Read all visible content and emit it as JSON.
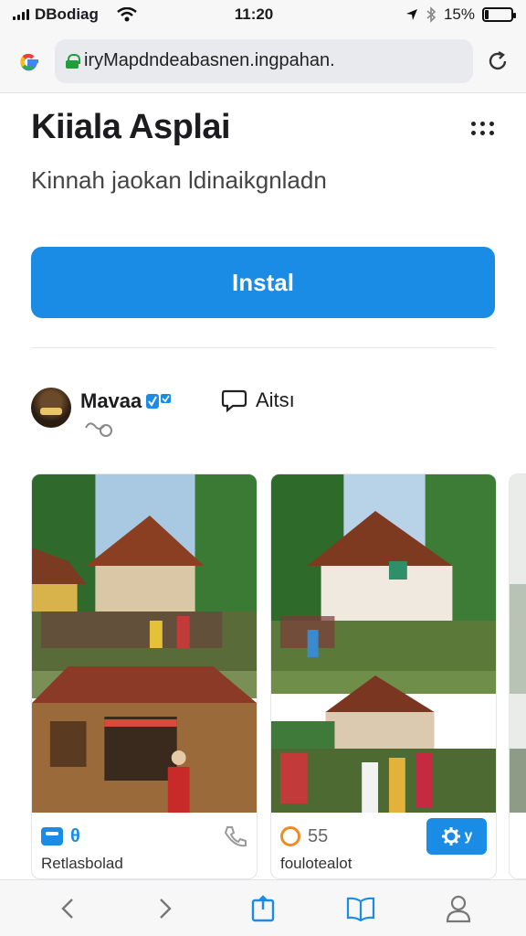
{
  "status_bar": {
    "carrier": "DBodiag",
    "time": "11:20",
    "battery": "15%",
    "battery_level": 0.15,
    "icons": [
      "signal-icon",
      "wifi-icon",
      "location-icon",
      "bluetooth-icon",
      "battery-icon"
    ]
  },
  "browser": {
    "url": "iryMapdndeabasnen.ingpahan.",
    "icons": [
      "google-logo-icon",
      "lock-icon",
      "reload-icon"
    ]
  },
  "app": {
    "title": "Kiiala Asplai",
    "subtitle": "Kinnah jaokan ldinaikgnladn",
    "install_label": "Instal"
  },
  "author": {
    "name": "Mavaa",
    "chat_label": "Aitsı"
  },
  "gallery": [
    {
      "count": "θ",
      "caption": "Retlasbolad"
    },
    {
      "count": "55",
      "caption": "foulotealot",
      "action_label": "y"
    }
  ],
  "colors": {
    "accent": "#1a8ce6",
    "lock_green": "#1e9e3d",
    "score_orange": "#f08a24",
    "background": "#ffffff",
    "bar_background": "#f7f7f8"
  },
  "toolbar": {
    "icons": [
      "back-icon",
      "forward-icon",
      "share-icon",
      "bookmarks-icon",
      "account-icon"
    ]
  }
}
